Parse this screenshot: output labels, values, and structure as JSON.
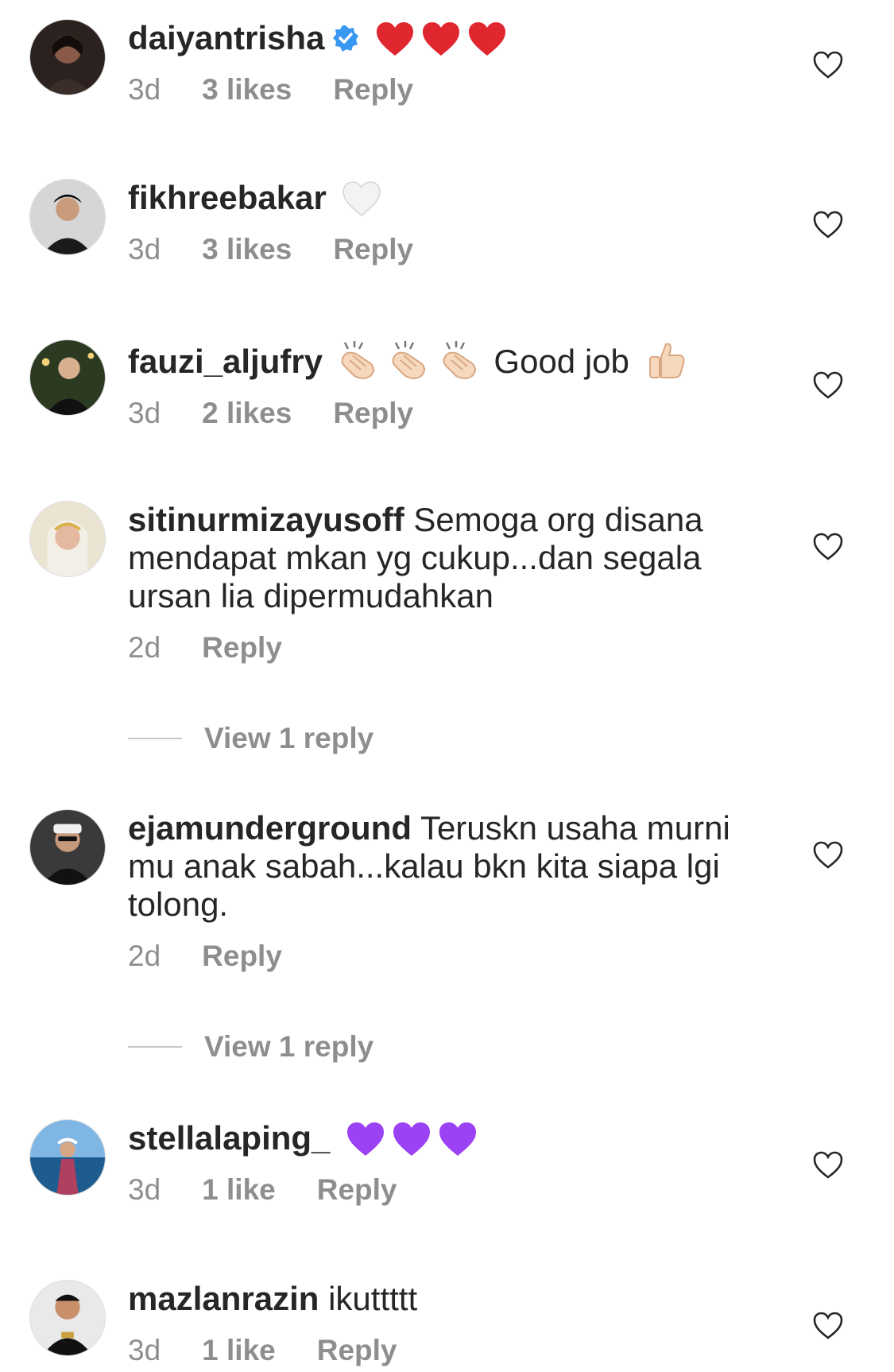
{
  "comments": [
    {
      "username": "daiyantrisha",
      "verified": true,
      "text": "",
      "emojis": [
        "red-heart",
        "red-heart",
        "red-heart"
      ],
      "time": "3d",
      "likes": "3 likes",
      "reply": "Reply"
    },
    {
      "username": "fikhreebakar",
      "text": "",
      "emojis": [
        "white-heart"
      ],
      "time": "3d",
      "likes": "3 likes",
      "reply": "Reply"
    },
    {
      "username": "fauzi_aljufry",
      "text": "Good job",
      "emojis": [
        "clapping-hands",
        "clapping-hands",
        "clapping-hands",
        "thumbs-up"
      ],
      "time": "3d",
      "likes": "2 likes",
      "reply": "Reply"
    },
    {
      "username": "sitinurmizayusoff",
      "text": "Semoga org disana mendapat mkan yg cukup...dan segala ursan lia dipermudahkan",
      "time": "2d",
      "likes": "",
      "reply": "Reply",
      "view_replies": "View 1 reply"
    },
    {
      "username": "ejamunderground",
      "text": "Teruskn usaha murni mu anak sabah...kalau bkn kita siapa lgi tolong.",
      "time": "2d",
      "likes": "",
      "reply": "Reply",
      "view_replies": "View 1 reply"
    },
    {
      "username": "stellalaping_",
      "text": "",
      "emojis": [
        "purple-heart",
        "purple-heart",
        "purple-heart"
      ],
      "time": "3d",
      "likes": "1 like",
      "reply": "Reply"
    },
    {
      "username": "mazlanrazin",
      "text": "ikuttttt",
      "time": "3d",
      "likes": "1 like",
      "reply": "Reply"
    }
  ],
  "colors": {
    "text": "#262626",
    "meta": "#8e8e8e",
    "verified": "#3897f0",
    "red_heart": "#e0262f",
    "purple_heart": "#9b42f5"
  },
  "icons": {
    "like": "heart-outline-icon",
    "verified": "verified-badge-icon"
  }
}
